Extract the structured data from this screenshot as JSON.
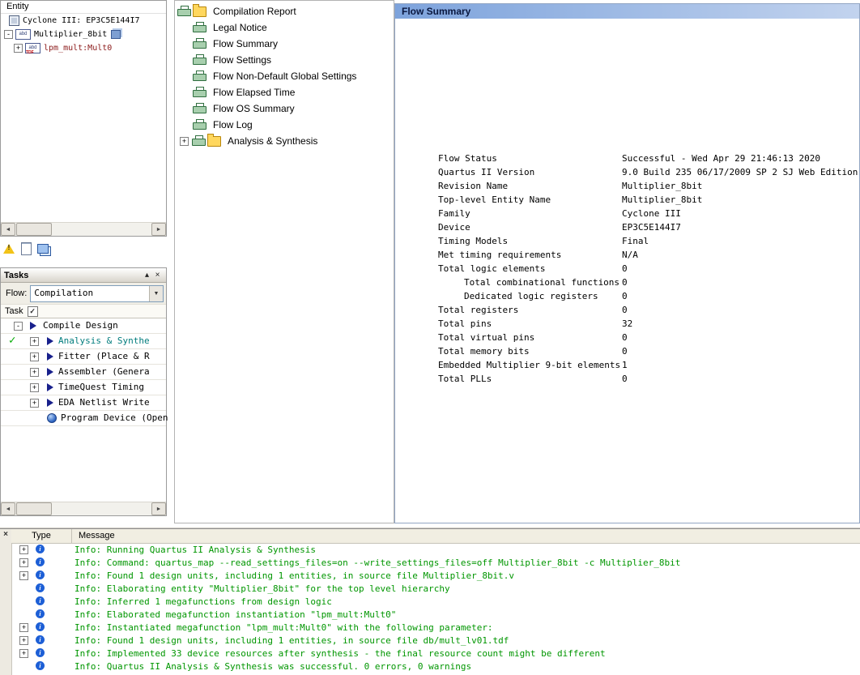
{
  "colors": {
    "message-green": "#009600",
    "info-blue": "#1d5fd6",
    "title-bar-start": "#7da3dc",
    "title-bar-end": "#c2d3ee",
    "check-green": "#00aa00",
    "selected-task": "#007c7c",
    "entity-sub-red": "#8b1a1a"
  },
  "entity_panel": {
    "header": "Entity",
    "items": [
      {
        "label": "Cyclone III: EP3C5E144I7"
      },
      {
        "label": "Multiplier_8bit",
        "expander": "-",
        "icon_text": "abd"
      },
      {
        "label": "lpm_mult:Mult0",
        "expander": "+",
        "icon_text": "abd",
        "icon_sub": "TDF"
      }
    ]
  },
  "navigator_toolbar": {
    "icons": [
      "warning-icon",
      "files-icon",
      "design-units-icon"
    ]
  },
  "tasks_panel": {
    "title": "Tasks",
    "collapse_button": "▴",
    "close_button": "×",
    "flow_label": "Flow:",
    "flow_value": "Compilation",
    "column_header": "Task",
    "rows": [
      {
        "label": "Compile Design",
        "expander": "-",
        "play": true,
        "classes": [
          "lvl1"
        ]
      },
      {
        "label": "Analysis & Synthe",
        "expander": "+",
        "play": true,
        "check": true,
        "classes": [
          "lvl2",
          "selected"
        ]
      },
      {
        "label": "Fitter (Place & R",
        "expander": "+",
        "play": true,
        "classes": [
          "lvl2"
        ]
      },
      {
        "label": "Assembler (Genera",
        "expander": "+",
        "play": true,
        "classes": [
          "lvl2"
        ]
      },
      {
        "label": "TimeQuest Timing",
        "expander": "+",
        "play": true,
        "classes": [
          "lvl2"
        ]
      },
      {
        "label": "EDA Netlist Write",
        "expander": "+",
        "play": true,
        "classes": [
          "lvl2"
        ]
      },
      {
        "label": "Program Device (Open",
        "program": true,
        "classes": [
          "lvl3"
        ]
      }
    ]
  },
  "report_tree": {
    "root_label": "Compilation Report",
    "items": [
      {
        "label": "Legal Notice"
      },
      {
        "label": "Flow Summary"
      },
      {
        "label": "Flow Settings"
      },
      {
        "label": "Flow Non-Default Global Settings"
      },
      {
        "label": "Flow Elapsed Time"
      },
      {
        "label": "Flow OS Summary"
      },
      {
        "label": "Flow Log"
      }
    ],
    "folder_row": {
      "label": "Analysis & Synthesis",
      "expander": "+"
    }
  },
  "flow_summary": {
    "title": "Flow Summary",
    "rows": [
      {
        "label": "Flow Status",
        "value": "Successful - Wed Apr 29 21:46:13 2020"
      },
      {
        "label": "Quartus II Version",
        "value": "9.0 Build 235 06/17/2009 SP 2 SJ Web Edition"
      },
      {
        "label": "Revision Name",
        "value": "Multiplier_8bit"
      },
      {
        "label": "Top-level Entity Name",
        "value": "Multiplier_8bit"
      },
      {
        "label": "Family",
        "value": "Cyclone III"
      },
      {
        "label": "Device",
        "value": "EP3C5E144I7"
      },
      {
        "label": "Timing Models",
        "value": "Final"
      },
      {
        "label": "Met timing requirements",
        "value": "N/A"
      },
      {
        "label": "Total logic elements",
        "value": "0"
      },
      {
        "label": "Total combinational functions",
        "value": "0",
        "classes": [
          "indent"
        ]
      },
      {
        "label": "Dedicated logic registers",
        "value": "0",
        "classes": [
          "indent"
        ]
      },
      {
        "label": "Total registers",
        "value": "0"
      },
      {
        "label": "Total pins",
        "value": "32"
      },
      {
        "label": "Total virtual pins",
        "value": "0"
      },
      {
        "label": "Total memory bits",
        "value": "0"
      },
      {
        "label": "Embedded Multiplier 9-bit elements",
        "value": "1"
      },
      {
        "label": "Total PLLs",
        "value": "0"
      }
    ]
  },
  "messages": {
    "close_button": "×",
    "columns": [
      "Type",
      "Message"
    ],
    "rows": [
      {
        "expand": true,
        "text": "Info: Running Quartus II Analysis & Synthesis"
      },
      {
        "expand": true,
        "text": "Info: Command: quartus_map --read_settings_files=on --write_settings_files=off Multiplier_8bit -c Multiplier_8bit"
      },
      {
        "expand": true,
        "text": "Info: Found 1 design units, including 1 entities, in source file Multiplier_8bit.v"
      },
      {
        "expand": false,
        "text": "Info: Elaborating entity \"Multiplier_8bit\" for the top level hierarchy"
      },
      {
        "expand": false,
        "text": "Info: Inferred 1 megafunctions from design logic"
      },
      {
        "expand": false,
        "text": "Info: Elaborated megafunction instantiation \"lpm_mult:Mult0\""
      },
      {
        "expand": true,
        "text": "Info: Instantiated megafunction \"lpm_mult:Mult0\" with the following parameter:"
      },
      {
        "expand": true,
        "text": "Info: Found 1 design units, including 1 entities, in source file db/mult_lv01.tdf"
      },
      {
        "expand": true,
        "text": "Info: Implemented 33 device resources after synthesis - the final resource count might be different"
      },
      {
        "expand": false,
        "text": "Info: Quartus II Analysis & Synthesis was successful. 0 errors, 0 warnings"
      }
    ]
  }
}
